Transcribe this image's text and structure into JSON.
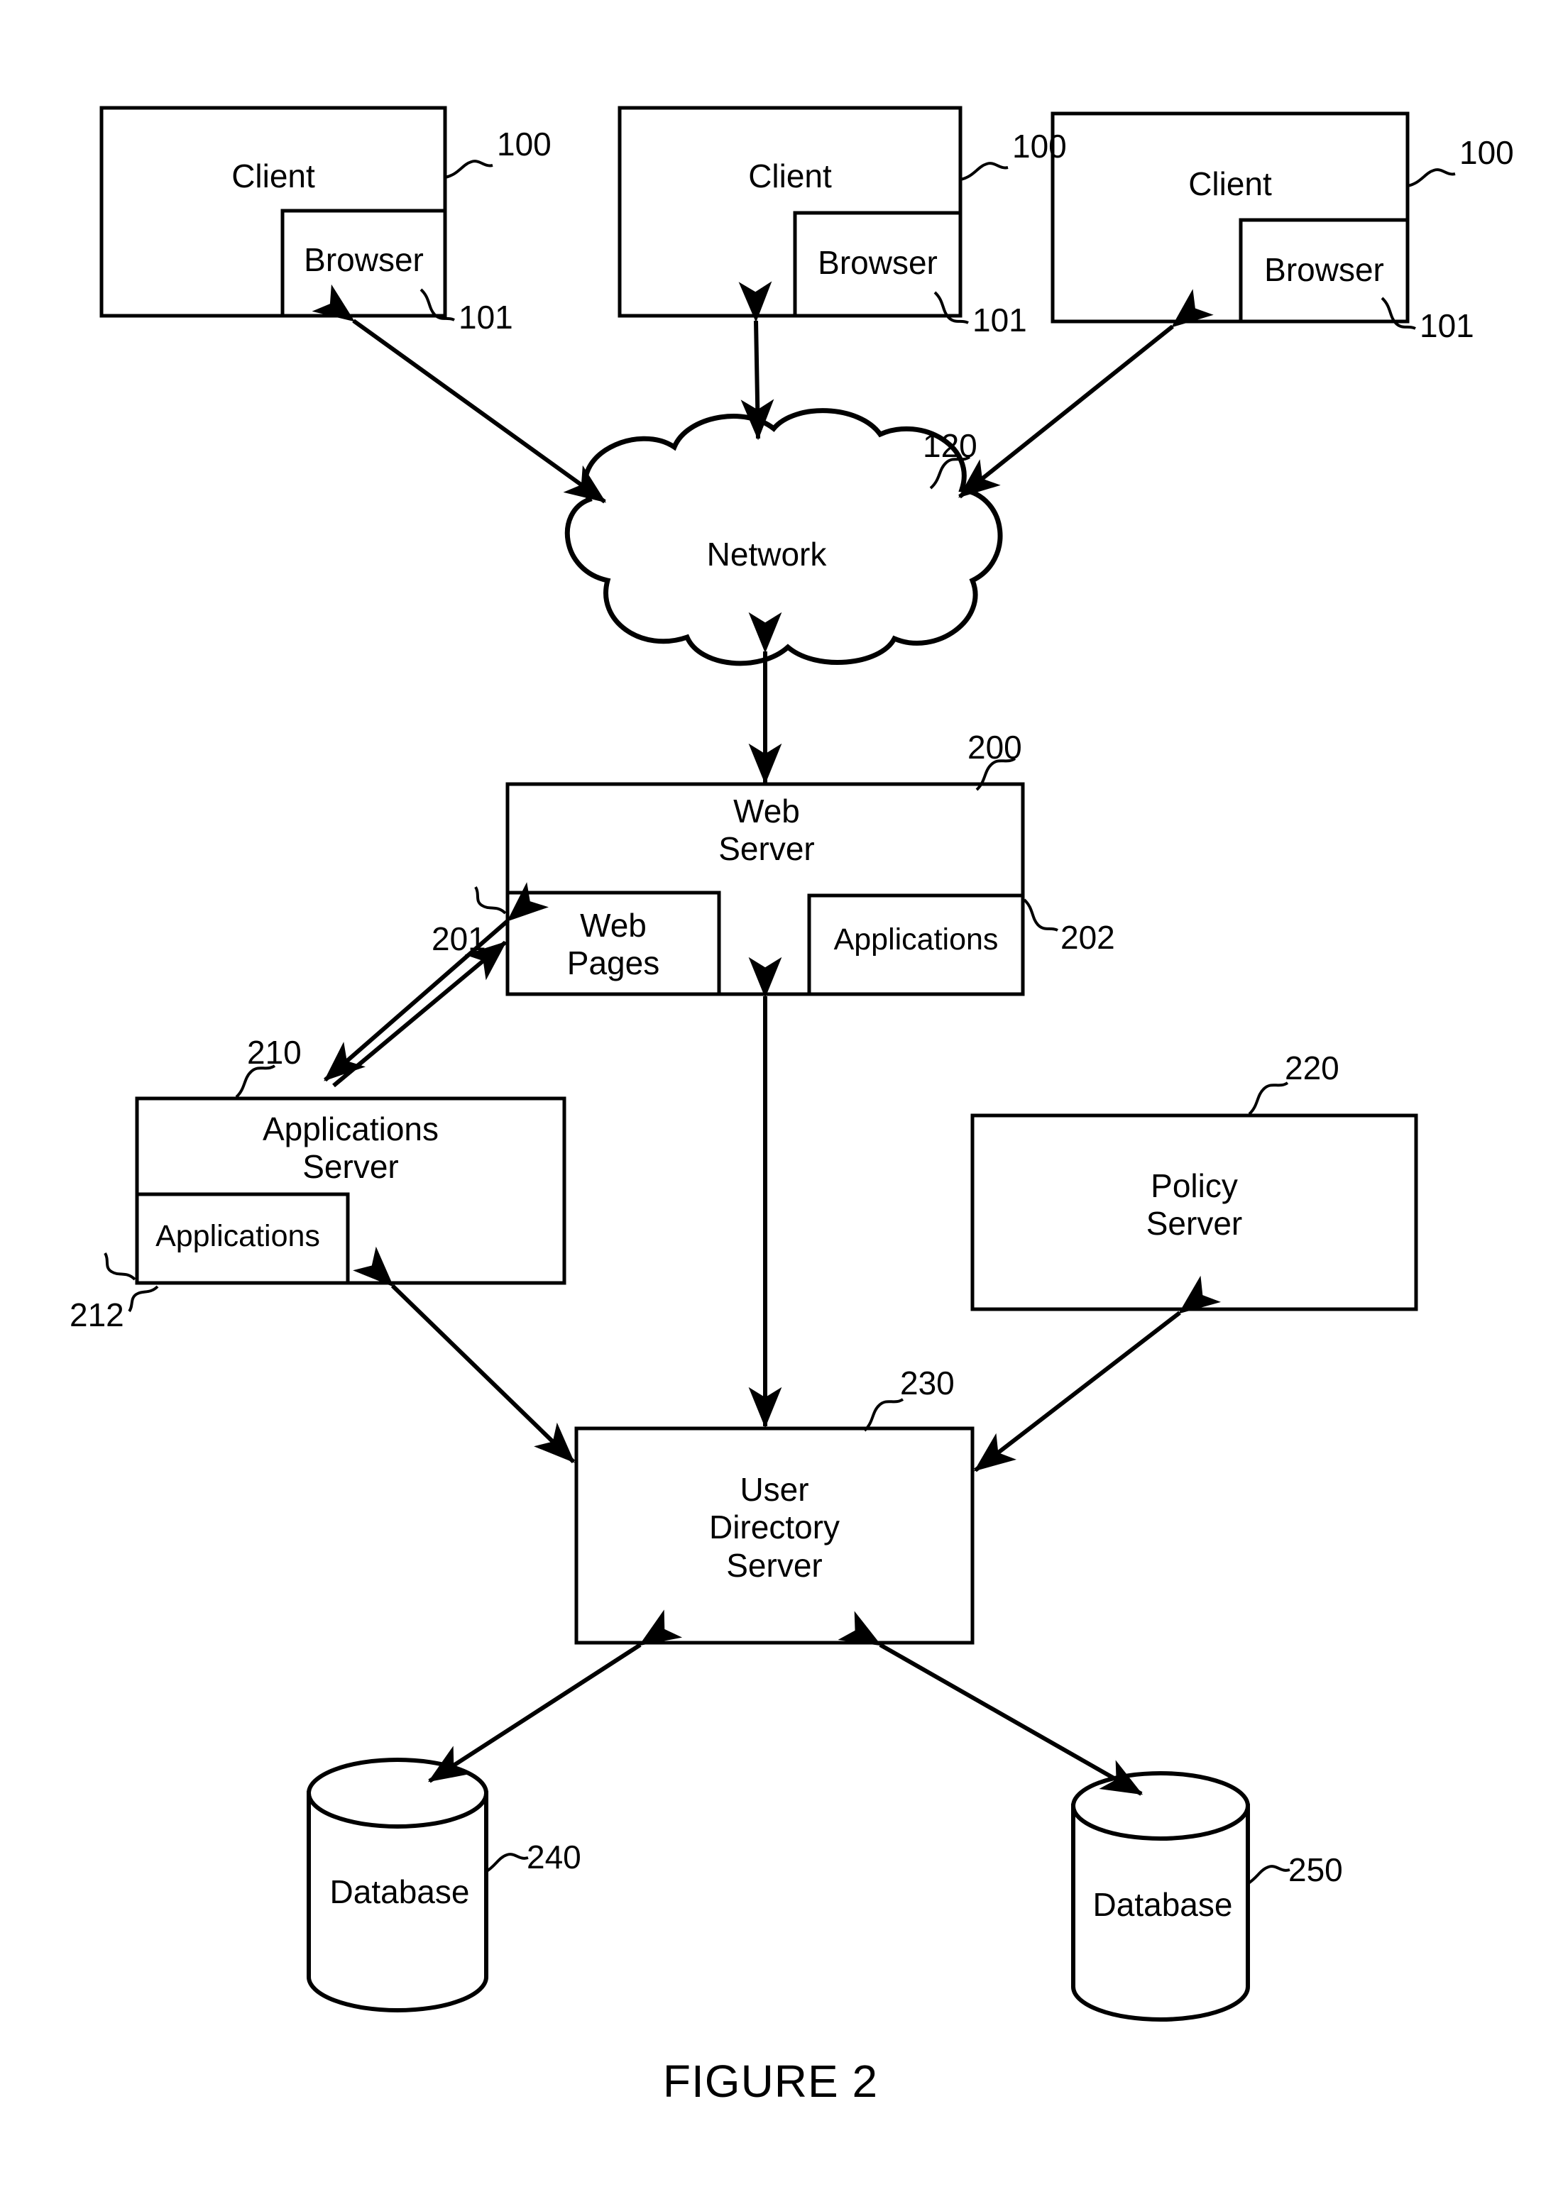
{
  "figure": {
    "caption": "FIGURE 2",
    "title": "Network system architecture diagram"
  },
  "colors": {
    "stroke": "#000000",
    "fill": "#ffffff",
    "text": "#000000"
  },
  "clients": [
    {
      "label": "Client",
      "ref": "100",
      "browser_label": "Browser",
      "browser_ref": "101"
    },
    {
      "label": "Client",
      "ref": "100",
      "browser_label": "Browser",
      "browser_ref": "101"
    },
    {
      "label": "Client",
      "ref": "100",
      "browser_label": "Browser",
      "browser_ref": "101"
    }
  ],
  "network": {
    "label": "Network",
    "ref": "120"
  },
  "web_server": {
    "label": "Web\nServer",
    "ref": "200",
    "web_pages": {
      "label": "Web\nPages",
      "ref": "201"
    },
    "applications": {
      "label": "Applications",
      "ref": "202"
    }
  },
  "applications_server": {
    "label": "Applications\nServer",
    "ref": "210",
    "applications": {
      "label": "Applications",
      "ref": "212"
    }
  },
  "policy_server": {
    "label": "Policy\nServer",
    "ref": "220"
  },
  "user_directory_server": {
    "label": "User\nDirectory\nServer",
    "ref": "230"
  },
  "databases": [
    {
      "label": "Database",
      "ref": "240"
    },
    {
      "label": "Database",
      "ref": "250"
    }
  ]
}
